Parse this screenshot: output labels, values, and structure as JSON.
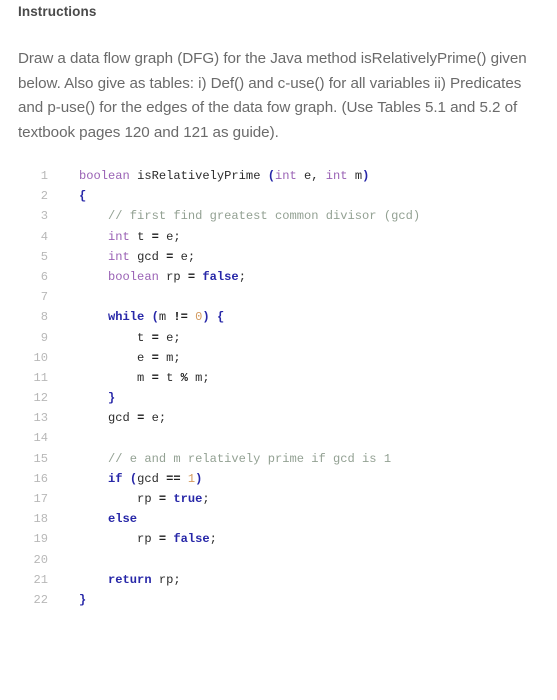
{
  "heading": {
    "title": "Instructions"
  },
  "instructions": {
    "paragraph": "Draw a data flow graph (DFG) for the Java method isRelativelyPrime() given below. Also give as tables: i) Def() and c-use() for all variables ii) Predicates and p-use() for the edges of the data fow graph. (Use Tables 5.1 and 5.2 of textbook pages 120 and 121 as guide)."
  },
  "code": {
    "language": "java",
    "line_count": 22,
    "line_numbers": [
      "1",
      "2",
      "3",
      "4",
      "5",
      "6",
      "7",
      "8",
      "9",
      "10",
      "11",
      "12",
      "13",
      "14",
      "15",
      "16",
      "17",
      "18",
      "19",
      "20",
      "21",
      "22"
    ],
    "lines": [
      "boolean isRelativelyPrime (int e, int m)",
      "{",
      "    // first find greatest common divisor (gcd)",
      "    int t = e;",
      "    int gcd = e;",
      "    boolean rp = false;",
      "",
      "    while (m != 0) {",
      "        t = e;",
      "        e = m;",
      "        m = t % m;",
      "    }",
      "    gcd = e;",
      "",
      "    // e and m relatively prime if gcd is 1",
      "    if (gcd == 1)",
      "        rp = true;",
      "    else",
      "        rp = false;",
      "",
      "    return rp;",
      "}"
    ],
    "tokens": [
      [
        {
          "t": "boolean",
          "c": "tok-type"
        },
        {
          "t": " isRelativelyPrime ",
          "c": "tok-id"
        },
        {
          "t": "(",
          "c": "tok-punc"
        },
        {
          "t": "int",
          "c": "tok-type"
        },
        {
          "t": " e, ",
          "c": "tok-id"
        },
        {
          "t": "int",
          "c": "tok-type"
        },
        {
          "t": " m",
          "c": "tok-id"
        },
        {
          "t": ")",
          "c": "tok-punc"
        }
      ],
      [
        {
          "t": "{",
          "c": "tok-brace"
        }
      ],
      [
        {
          "t": "    ",
          "c": "tok-id"
        },
        {
          "t": "// first find greatest common divisor (gcd)",
          "c": "tok-cmt"
        }
      ],
      [
        {
          "t": "    ",
          "c": "tok-id"
        },
        {
          "t": "int",
          "c": "tok-type"
        },
        {
          "t": " t ",
          "c": "tok-id"
        },
        {
          "t": "=",
          "c": "tok-op"
        },
        {
          "t": " e;",
          "c": "tok-id"
        }
      ],
      [
        {
          "t": "    ",
          "c": "tok-id"
        },
        {
          "t": "int",
          "c": "tok-type"
        },
        {
          "t": " gcd ",
          "c": "tok-id"
        },
        {
          "t": "=",
          "c": "tok-op"
        },
        {
          "t": " e;",
          "c": "tok-id"
        }
      ],
      [
        {
          "t": "    ",
          "c": "tok-id"
        },
        {
          "t": "boolean",
          "c": "tok-type"
        },
        {
          "t": " rp ",
          "c": "tok-id"
        },
        {
          "t": "=",
          "c": "tok-op"
        },
        {
          "t": " ",
          "c": "tok-id"
        },
        {
          "t": "false",
          "c": "tok-kw"
        },
        {
          "t": ";",
          "c": "tok-id"
        }
      ],
      [
        {
          "t": "",
          "c": "tok-id"
        }
      ],
      [
        {
          "t": "    ",
          "c": "tok-id"
        },
        {
          "t": "while",
          "c": "tok-kw"
        },
        {
          "t": " ",
          "c": "tok-id"
        },
        {
          "t": "(",
          "c": "tok-punc"
        },
        {
          "t": "m ",
          "c": "tok-id"
        },
        {
          "t": "!=",
          "c": "tok-op"
        },
        {
          "t": " ",
          "c": "tok-id"
        },
        {
          "t": "0",
          "c": "tok-num"
        },
        {
          "t": ")",
          "c": "tok-punc"
        },
        {
          "t": " ",
          "c": "tok-id"
        },
        {
          "t": "{",
          "c": "tok-brace"
        }
      ],
      [
        {
          "t": "        t ",
          "c": "tok-id"
        },
        {
          "t": "=",
          "c": "tok-op"
        },
        {
          "t": " e;",
          "c": "tok-id"
        }
      ],
      [
        {
          "t": "        e ",
          "c": "tok-id"
        },
        {
          "t": "=",
          "c": "tok-op"
        },
        {
          "t": " m;",
          "c": "tok-id"
        }
      ],
      [
        {
          "t": "        m ",
          "c": "tok-id"
        },
        {
          "t": "=",
          "c": "tok-op"
        },
        {
          "t": " t ",
          "c": "tok-id"
        },
        {
          "t": "%",
          "c": "tok-op"
        },
        {
          "t": " m;",
          "c": "tok-id"
        }
      ],
      [
        {
          "t": "    ",
          "c": "tok-id"
        },
        {
          "t": "}",
          "c": "tok-brace"
        }
      ],
      [
        {
          "t": "    gcd ",
          "c": "tok-id"
        },
        {
          "t": "=",
          "c": "tok-op"
        },
        {
          "t": " e;",
          "c": "tok-id"
        }
      ],
      [
        {
          "t": "",
          "c": "tok-id"
        }
      ],
      [
        {
          "t": "    ",
          "c": "tok-id"
        },
        {
          "t": "// e and m relatively prime if gcd is 1",
          "c": "tok-cmt"
        }
      ],
      [
        {
          "t": "    ",
          "c": "tok-id"
        },
        {
          "t": "if",
          "c": "tok-kw"
        },
        {
          "t": " ",
          "c": "tok-id"
        },
        {
          "t": "(",
          "c": "tok-punc"
        },
        {
          "t": "gcd ",
          "c": "tok-id"
        },
        {
          "t": "==",
          "c": "tok-op"
        },
        {
          "t": " ",
          "c": "tok-id"
        },
        {
          "t": "1",
          "c": "tok-num"
        },
        {
          "t": ")",
          "c": "tok-punc"
        }
      ],
      [
        {
          "t": "        rp ",
          "c": "tok-id"
        },
        {
          "t": "=",
          "c": "tok-op"
        },
        {
          "t": " ",
          "c": "tok-id"
        },
        {
          "t": "true",
          "c": "tok-kw"
        },
        {
          "t": ";",
          "c": "tok-id"
        }
      ],
      [
        {
          "t": "    ",
          "c": "tok-id"
        },
        {
          "t": "else",
          "c": "tok-kw"
        }
      ],
      [
        {
          "t": "        rp ",
          "c": "tok-id"
        },
        {
          "t": "=",
          "c": "tok-op"
        },
        {
          "t": " ",
          "c": "tok-id"
        },
        {
          "t": "false",
          "c": "tok-kw"
        },
        {
          "t": ";",
          "c": "tok-id"
        }
      ],
      [
        {
          "t": "",
          "c": "tok-id"
        }
      ],
      [
        {
          "t": "    ",
          "c": "tok-id"
        },
        {
          "t": "return",
          "c": "tok-kw"
        },
        {
          "t": " rp;",
          "c": "tok-id"
        }
      ],
      [
        {
          "t": "}",
          "c": "tok-brace"
        }
      ]
    ]
  },
  "colors": {
    "background": "#ffffff",
    "heading_text": "#4a4a4a",
    "body_text": "#6a6a6a",
    "line_number": "#b8b8b8",
    "code_default": "#2b2b2b",
    "keyword": "#2727a8",
    "type": "#9a62b5",
    "comment": "#93a193",
    "number": "#d39a5e"
  }
}
